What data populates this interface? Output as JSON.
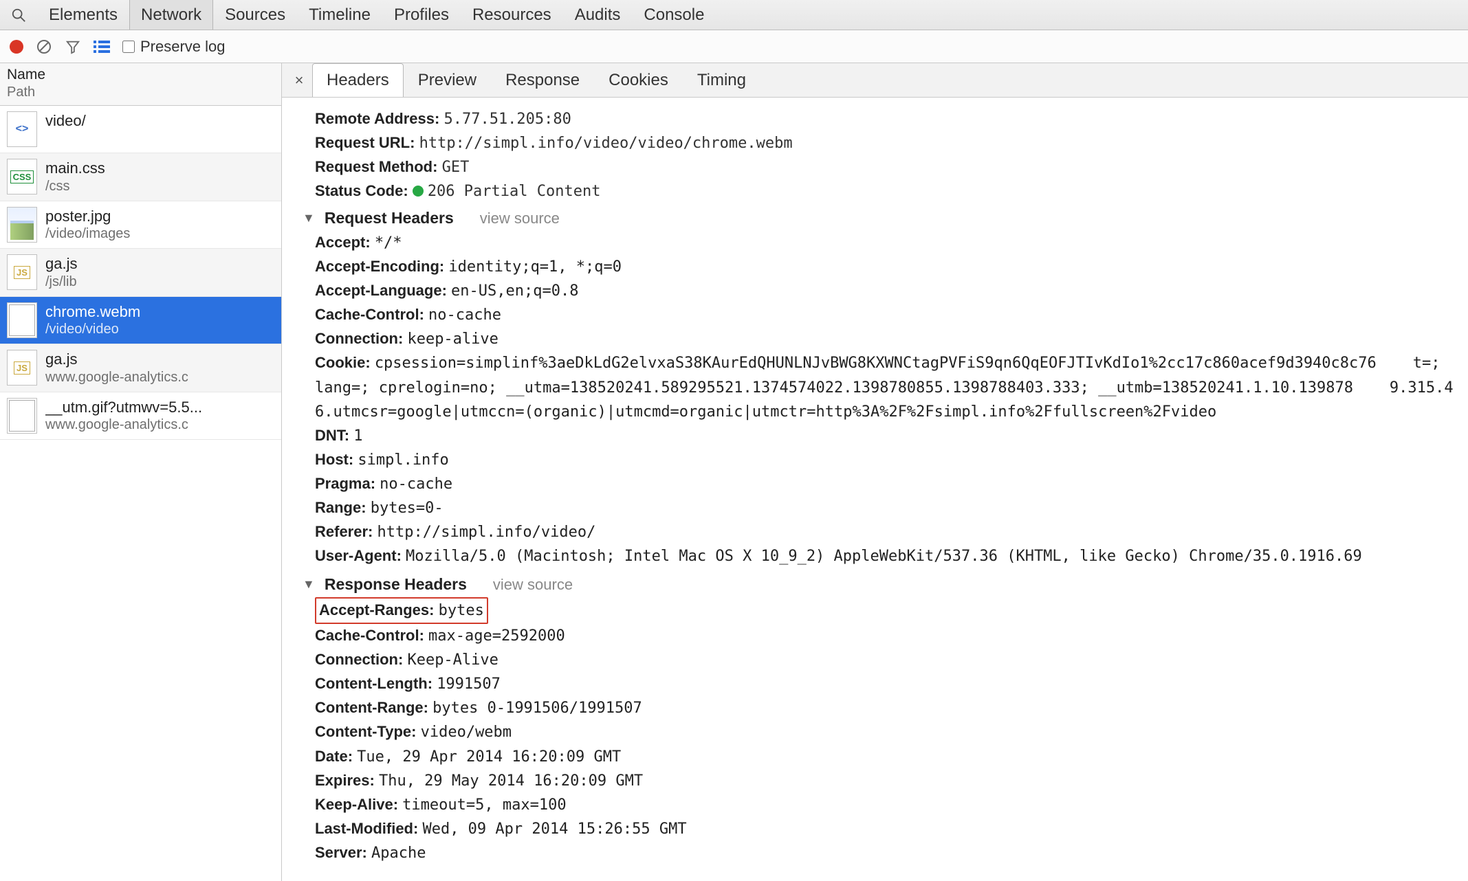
{
  "top_tabs": [
    "Elements",
    "Network",
    "Sources",
    "Timeline",
    "Profiles",
    "Resources",
    "Audits",
    "Console"
  ],
  "top_tab_active": 1,
  "toolbar": {
    "preserve_log_label": "Preserve log"
  },
  "sidebar": {
    "header": {
      "name_label": "Name",
      "path_label": "Path"
    },
    "selected_index": 4,
    "items": [
      {
        "name": "video/",
        "path": "",
        "kind": "html"
      },
      {
        "name": "main.css",
        "path": "/css",
        "kind": "css"
      },
      {
        "name": "poster.jpg",
        "path": "/video/images",
        "kind": "img"
      },
      {
        "name": "ga.js",
        "path": "/js/lib",
        "kind": "js"
      },
      {
        "name": "chrome.webm",
        "path": "/video/video",
        "kind": "doc"
      },
      {
        "name": "ga.js",
        "path": "www.google-analytics.c",
        "kind": "js"
      },
      {
        "name": "__utm.gif?utmwv=5.5...",
        "path": "www.google-analytics.c",
        "kind": "doc"
      }
    ]
  },
  "detail": {
    "tabs": [
      "Headers",
      "Preview",
      "Response",
      "Cookies",
      "Timing"
    ],
    "active_tab": 0,
    "general": {
      "remote_address_label": "Remote Address",
      "remote_address": "5.77.51.205:80",
      "request_url_label": "Request URL",
      "request_url": "http://simpl.info/video/video/chrome.webm",
      "request_method_label": "Request Method",
      "request_method": "GET",
      "status_code_label": "Status Code",
      "status_code": "206 Partial Content"
    },
    "request_headers_title": "Request Headers",
    "response_headers_title": "Response Headers",
    "view_source_label": "view source",
    "request_headers": [
      {
        "k": "Accept",
        "v": "*/*"
      },
      {
        "k": "Accept-Encoding",
        "v": "identity;q=1, *;q=0"
      },
      {
        "k": "Accept-Language",
        "v": "en-US,en;q=0.8"
      },
      {
        "k": "Cache-Control",
        "v": "no-cache"
      },
      {
        "k": "Connection",
        "v": "keep-alive"
      },
      {
        "k": "Cookie",
        "v": "cpsession=simplinf%3aeDkLdG2elvxaS38KAurEdQHUNLNJvBWG8KXWNCtagPVFiS9qn6QqEOFJTIvKdIo1%2cc17c860acef9d3940c8c76    t=; lang=; cprelogin=no; __utma=138520241.589295521.1374574022.1398780855.1398788403.333; __utmb=138520241.1.10.139878    9.315.46.utmcsr=google|utmccn=(organic)|utmcmd=organic|utmctr=http%3A%2F%2Fsimpl.info%2Ffullscreen%2Fvideo"
      },
      {
        "k": "DNT",
        "v": "1"
      },
      {
        "k": "Host",
        "v": "simpl.info"
      },
      {
        "k": "Pragma",
        "v": "no-cache"
      },
      {
        "k": "Range",
        "v": "bytes=0-"
      },
      {
        "k": "Referer",
        "v": "http://simpl.info/video/"
      },
      {
        "k": "User-Agent",
        "v": "Mozilla/5.0 (Macintosh; Intel Mac OS X 10_9_2) AppleWebKit/537.36 (KHTML, like Gecko) Chrome/35.0.1916.69"
      }
    ],
    "response_headers": [
      {
        "k": "Accept-Ranges",
        "v": "bytes",
        "highlight": true
      },
      {
        "k": "Cache-Control",
        "v": "max-age=2592000"
      },
      {
        "k": "Connection",
        "v": "Keep-Alive"
      },
      {
        "k": "Content-Length",
        "v": "1991507"
      },
      {
        "k": "Content-Range",
        "v": "bytes 0-1991506/1991507"
      },
      {
        "k": "Content-Type",
        "v": "video/webm"
      },
      {
        "k": "Date",
        "v": "Tue, 29 Apr 2014 16:20:09 GMT"
      },
      {
        "k": "Expires",
        "v": "Thu, 29 May 2014 16:20:09 GMT"
      },
      {
        "k": "Keep-Alive",
        "v": "timeout=5, max=100"
      },
      {
        "k": "Last-Modified",
        "v": "Wed, 09 Apr 2014 15:26:55 GMT"
      },
      {
        "k": "Server",
        "v": "Apache"
      }
    ]
  }
}
